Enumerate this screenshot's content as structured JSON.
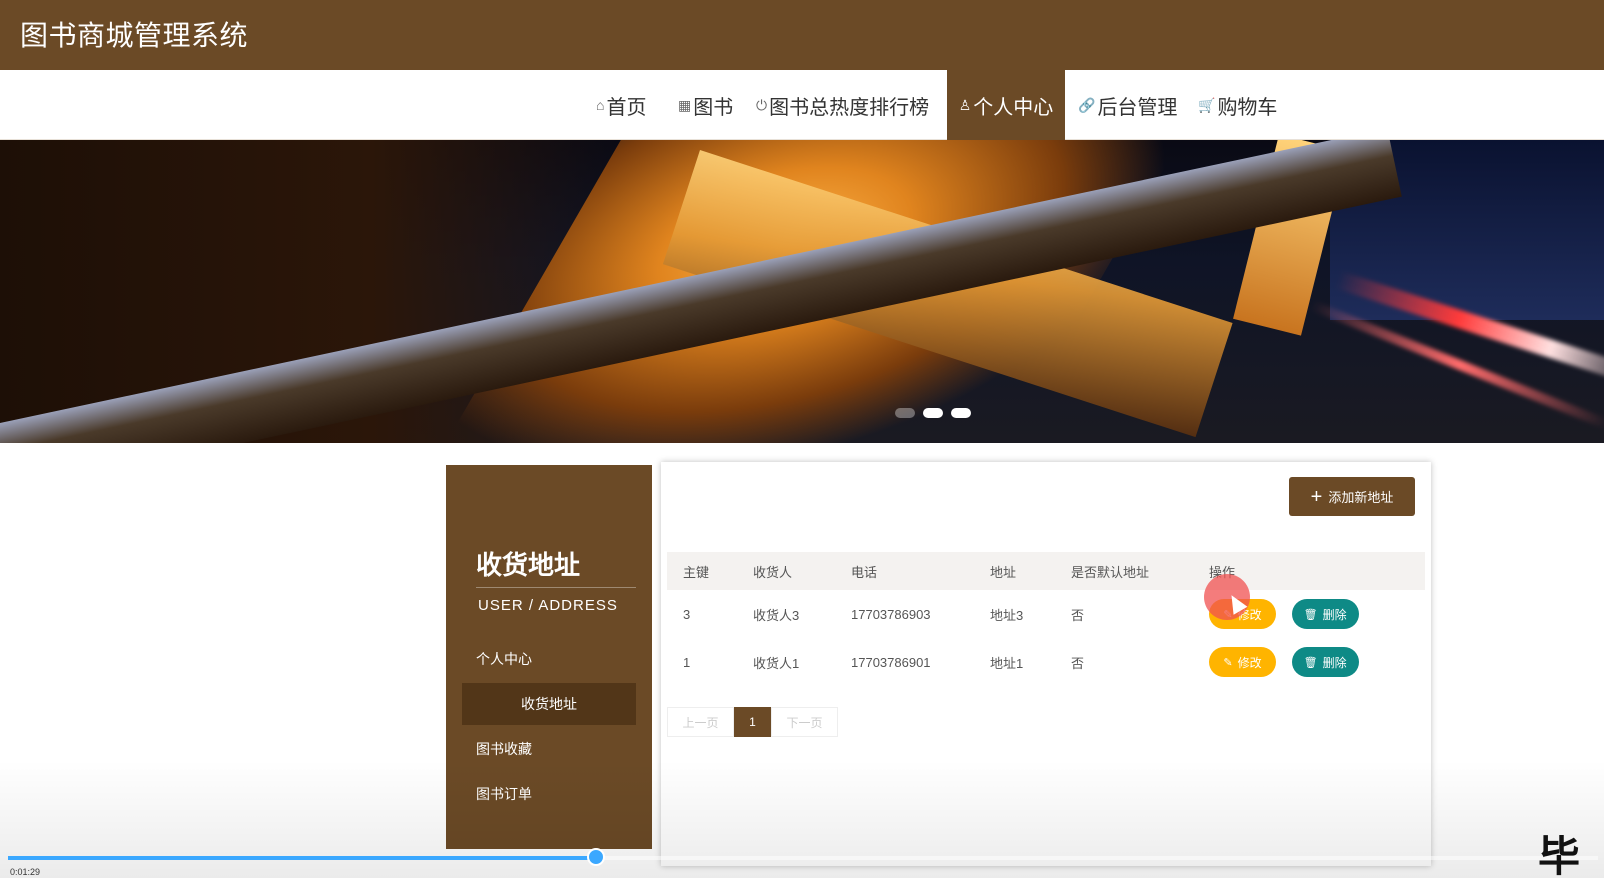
{
  "header": {
    "title": "图书商城管理系统"
  },
  "nav": {
    "items": [
      {
        "label": "首页",
        "icon": "home-icon"
      },
      {
        "label": "图书",
        "icon": "grid-icon"
      },
      {
        "label": "图书总热度排行榜",
        "icon": "power-icon"
      },
      {
        "label": "个人中心",
        "icon": "user-icon",
        "active": true
      },
      {
        "label": "后台管理",
        "icon": "link-icon"
      },
      {
        "label": "购物车",
        "icon": "cart-icon"
      }
    ]
  },
  "banner": {
    "slides": 3,
    "active_index": 1
  },
  "sidebar": {
    "title": "收货地址",
    "subtitle": "USER / ADDRESS",
    "items": [
      {
        "label": "个人中心"
      },
      {
        "label": "收货地址",
        "active": true
      },
      {
        "label": "图书收藏"
      },
      {
        "label": "图书订单"
      }
    ]
  },
  "main": {
    "add_button": "添加新地址",
    "table": {
      "headers": [
        "主键",
        "收货人",
        "电话",
        "地址",
        "是否默认地址",
        "操作"
      ],
      "rows": [
        {
          "id": "3",
          "name": "收货人3",
          "phone": "17703786903",
          "address": "地址3",
          "is_default": "否"
        },
        {
          "id": "1",
          "name": "收货人1",
          "phone": "17703786901",
          "address": "地址1",
          "is_default": "否"
        }
      ],
      "edit_label": "修改",
      "delete_label": "删除"
    },
    "pagination": {
      "prev": "上一页",
      "current": "1",
      "next": "下一页"
    }
  },
  "video": {
    "time": "0:01:29",
    "progress": 0.37
  },
  "watermark": "毕",
  "colors": {
    "brand": "#6b4a26",
    "edit": "#ffb400",
    "delete": "#0e8a86",
    "progress": "#3ba8ff"
  }
}
